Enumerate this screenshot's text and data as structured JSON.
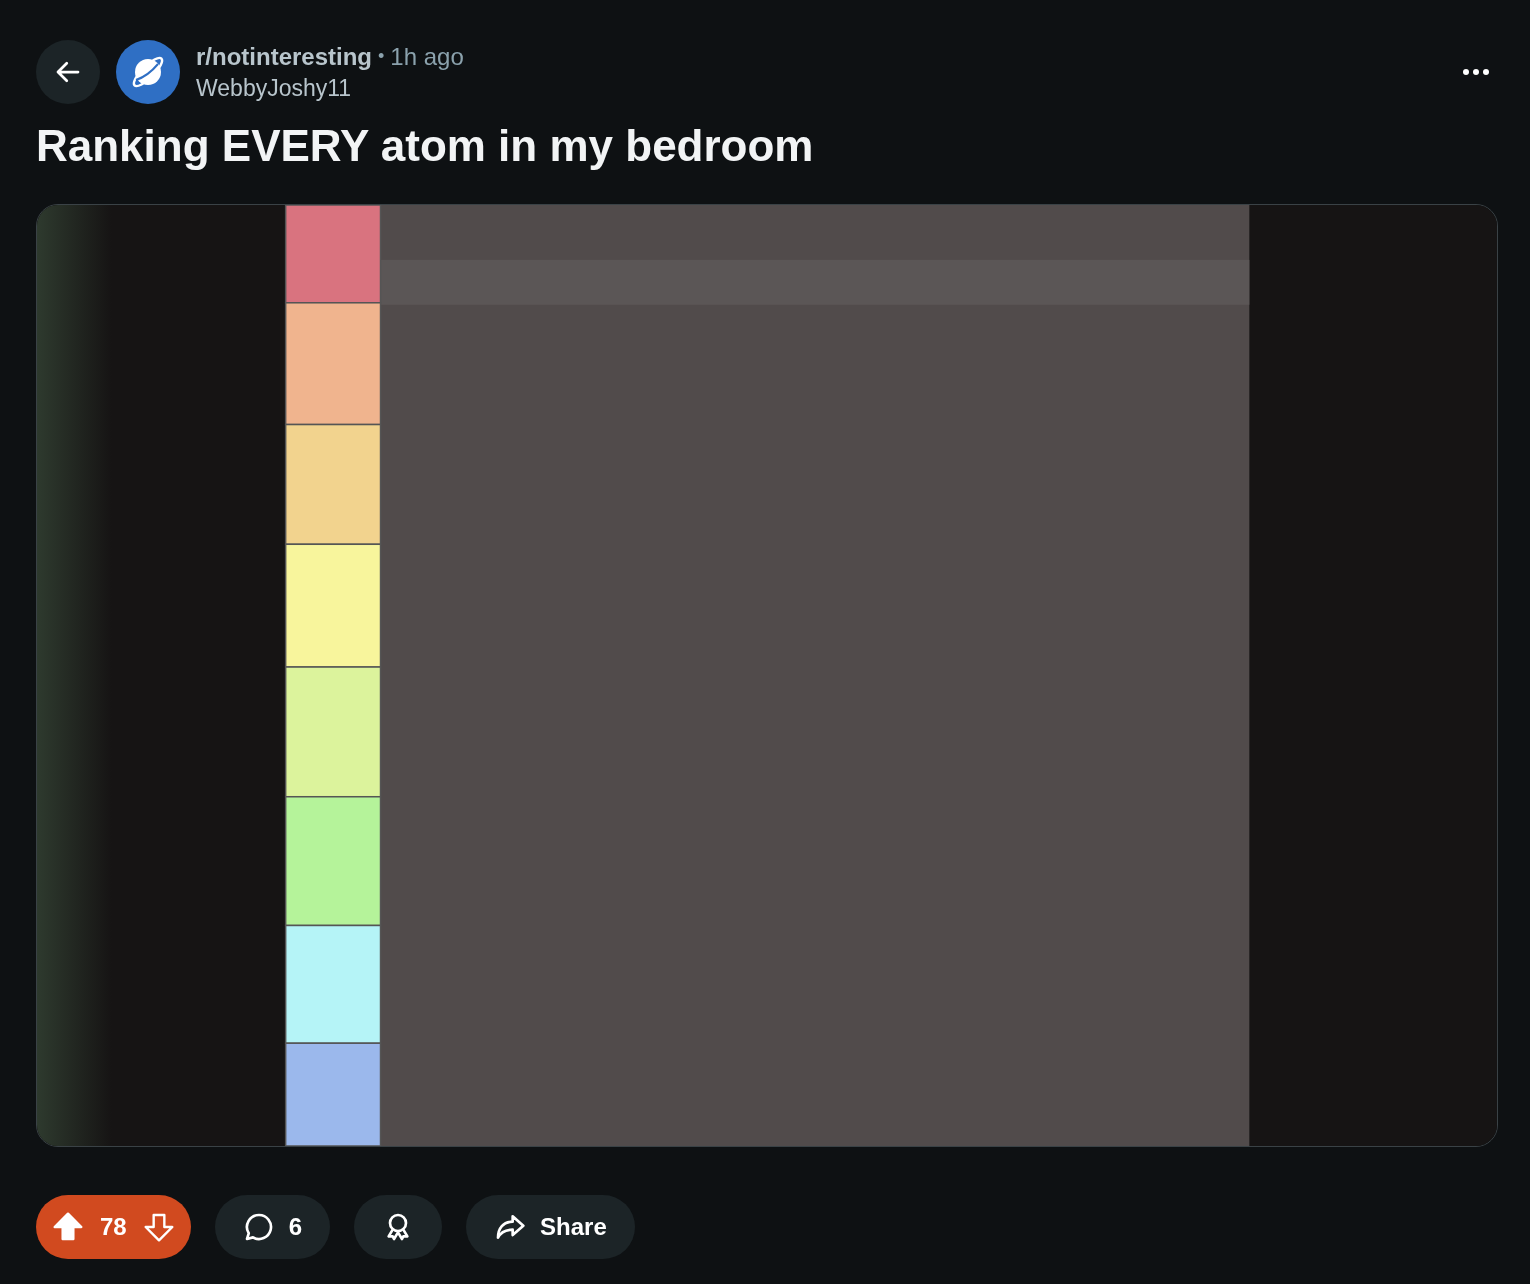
{
  "post": {
    "subreddit": "r/notinteresting",
    "separator": "•",
    "time": "1h ago",
    "author": "WebbyJoshy11",
    "title": "Ranking EVERY atom in my bedroom"
  },
  "actions": {
    "vote": {
      "count": "78",
      "upvoted": true
    },
    "comments": {
      "count": "6"
    },
    "share": {
      "label": "Share"
    }
  }
}
